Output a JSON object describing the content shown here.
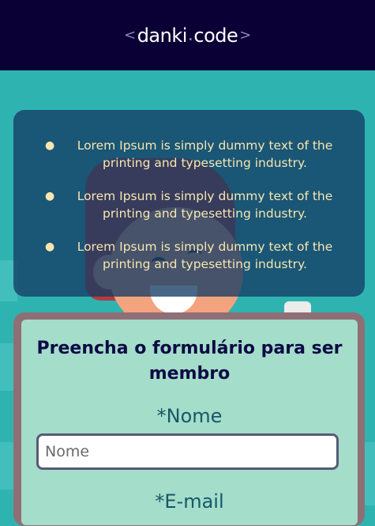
{
  "header": {
    "logo_left_bracket": "<",
    "logo_word1": "danki",
    "logo_dot": ".",
    "logo_word2": "code",
    "logo_right_bracket": ">"
  },
  "info": {
    "items": [
      "Lorem Ipsum is simply dummy text of the printing and typesetting industry.",
      "Lorem Ipsum is simply dummy text of the printing and typesetting industry.",
      "Lorem Ipsum is simply dummy text of the printing and typesetting industry."
    ]
  },
  "form": {
    "title": "Preencha o formulário para ser membro",
    "name_label": "*Nome",
    "name_placeholder": "Nome",
    "email_label": "*E-mail"
  },
  "colors": {
    "header_bg": "#0b0035",
    "page_bg": "#2fb3b0",
    "info_bg": "#143c64",
    "info_text": "#f7e6b0",
    "form_bg": "#a4ddca",
    "form_title": "#0e0a45",
    "label": "#175767"
  }
}
